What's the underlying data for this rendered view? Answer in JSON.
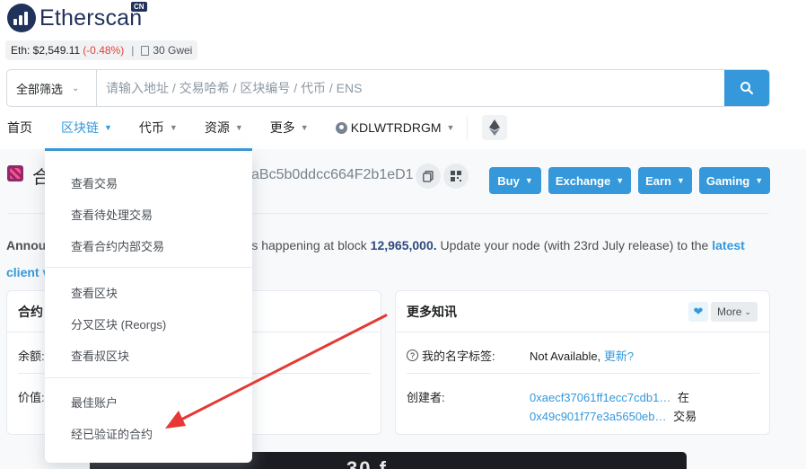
{
  "logo": {
    "text": "Etherscan",
    "badge": "CN"
  },
  "price": {
    "eth": "Eth: $2,549.11",
    "change": "(-0.48%)",
    "separator": "|",
    "gas": "30 Gwei"
  },
  "search": {
    "filter": "全部筛选",
    "placeholder": "请输入地址 / 交易哈希 / 区块编号 / 代币 / ENS",
    "icon": "search-icon"
  },
  "nav": {
    "items": [
      {
        "label": "首页"
      },
      {
        "label": "区块链"
      },
      {
        "label": "代币"
      },
      {
        "label": "资源"
      },
      {
        "label": "更多"
      },
      {
        "label": "KDLWTRDRGM"
      }
    ]
  },
  "dropdown": {
    "items": [
      "查看交易",
      "查看待处理交易",
      "查看合约内部交易",
      "查看区块",
      "分叉区块 (Reorgs)",
      "查看叔区块",
      "最佳账户",
      "经已验证的合约"
    ]
  },
  "page": {
    "title_char": "合",
    "address": "aBc5b0ddcc664F2b1eD1",
    "buttons": [
      "Buy",
      "Exchange",
      "Earn",
      "Gaming"
    ]
  },
  "announcement": {
    "prefix": "Annou",
    "mid": "s happening at block ",
    "block": "12,965,000.",
    "rest": " Update your node (with 23rd July release) to the ",
    "link": "latest",
    "line2_link": "client v"
  },
  "left_card": {
    "title": "合约",
    "rows": [
      "余额:",
      "价值:"
    ]
  },
  "right_card": {
    "title": "更多知讯",
    "more": "More",
    "name_tag_label": "我的名字标签:",
    "name_tag_value": "Not Available,",
    "name_tag_link": "更新?",
    "creator_label": "创建者:",
    "creator_address": "0xaecf37061ff1ecc7cdb1…",
    "creator_at": "在",
    "creator_tx": "0x49c901f77e3a5650eb…",
    "creator_tx_suffix": "交易"
  },
  "banner": {
    "text": "30 f"
  },
  "colors": {
    "accent": "#3498db",
    "brand": "#21325b",
    "negative": "#de4437",
    "annotation": "#e53935"
  }
}
